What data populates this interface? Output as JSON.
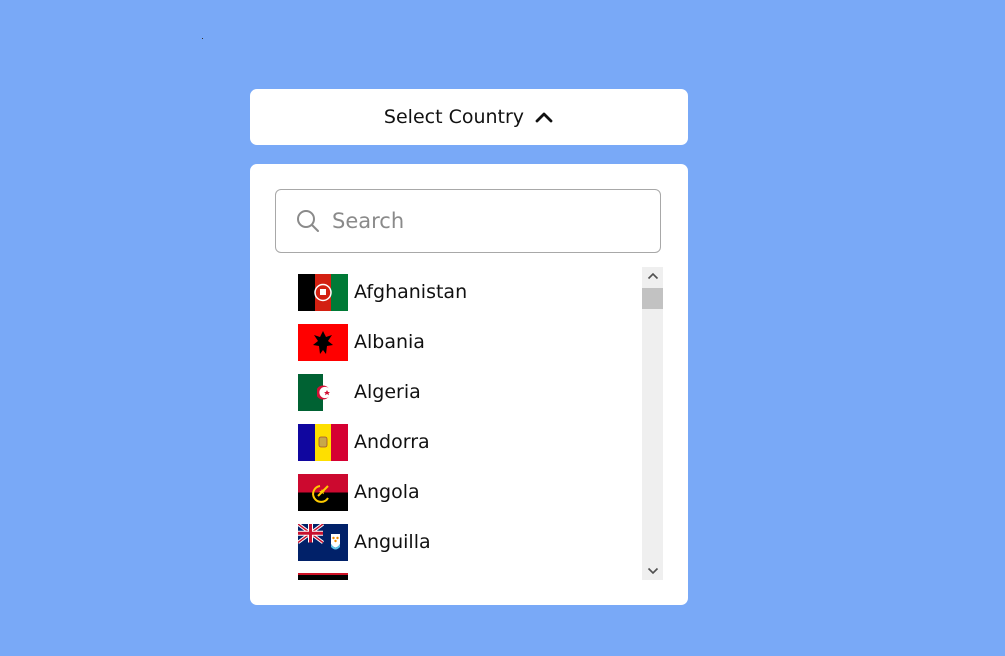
{
  "dropdown": {
    "label": "Select Country",
    "state_icon": "chevron-up-icon"
  },
  "search": {
    "placeholder": "Search",
    "value": "",
    "icon": "search-icon"
  },
  "countries": [
    {
      "name": "Afghanistan",
      "flag": "flag-afghanistan"
    },
    {
      "name": "Albania",
      "flag": "flag-albania"
    },
    {
      "name": "Algeria",
      "flag": "flag-algeria"
    },
    {
      "name": "Andorra",
      "flag": "flag-andorra"
    },
    {
      "name": "Angola",
      "flag": "flag-angola"
    },
    {
      "name": "Anguilla",
      "flag": "flag-anguilla"
    }
  ],
  "colors": {
    "background": "#79a9f7",
    "panel": "#ffffff",
    "scrollbar_track": "#efefef",
    "scrollbar_thumb": "#c2c2c2"
  }
}
